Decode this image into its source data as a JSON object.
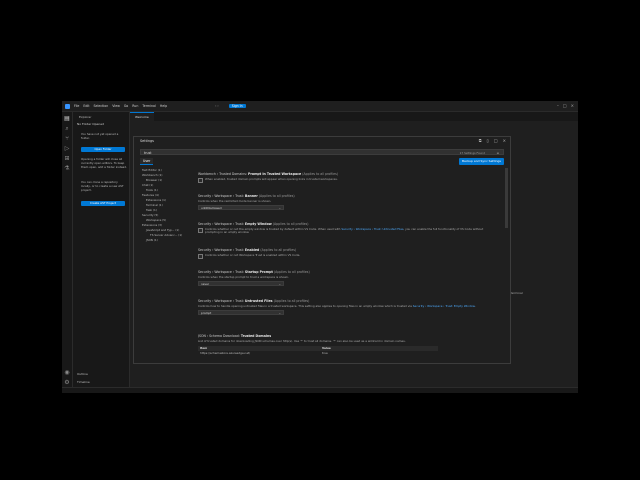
{
  "titlebar": {
    "menus": [
      "File",
      "Edit",
      "Selection",
      "View",
      "Go",
      "Run",
      "Terminal",
      "Help"
    ],
    "search_placeholder": "",
    "sign_in": "Sign In"
  },
  "sidebar": {
    "title": "Explorer",
    "section": "No Folder Opened",
    "text1": "You have not yet opened a folder.",
    "open_folder": "Open Folder",
    "text2": "Opening a folder will close all currently open editors. To keep them open, add a folder instead.",
    "text3": "You can clone a repository locally, or to create a new AST project.",
    "create_project": "Create AST Project",
    "outline": "Outline",
    "timeline": "Timeline"
  },
  "editor_tab": "Welcome",
  "dialog": {
    "title": "Settings",
    "search_value": "trust",
    "result_count": "17 Settings Found",
    "user_tab": "User",
    "backup_button": "Backup and Sync Settings",
    "tree": [
      {
        "label": "Text Editor (1)",
        "indent": 0
      },
      {
        "label": "Workbench (1)",
        "indent": 0
      },
      {
        "label": "Browser (1)",
        "indent": 1
      },
      {
        "label": "Chat (1)",
        "indent": 0
      },
      {
        "label": "Tools (1)",
        "indent": 1
      },
      {
        "label": "Features (4)",
        "indent": 0
      },
      {
        "label": "Extensions (1)",
        "indent": 1
      },
      {
        "label": "Terminal (1)",
        "indent": 1
      },
      {
        "label": "Task (1)",
        "indent": 1
      },
      {
        "label": "Security (5)",
        "indent": 0
      },
      {
        "label": "Workspace (5)",
        "indent": 1
      },
      {
        "label": "Extensions (3)",
        "indent": 0
      },
      {
        "label": "JavaScript and Typ... (1)",
        "indent": 1
      },
      {
        "label": "TS Server Advanc... (1)",
        "indent": 2
      },
      {
        "label": "JSON (1)",
        "indent": 1
      }
    ],
    "settings": {
      "s1": {
        "prefix": "Workbench › Trusted Domains: ",
        "name": "Prompt In Trusted Workspace",
        "scope": "(Applies to all profiles)",
        "desc": "When enabled, trusted domain prompts will appear when opening links in trusted workspaces."
      },
      "s2": {
        "prefix": "Security › Workspace › Trust: ",
        "name": "Banner",
        "scope": "(Applies to all profiles)",
        "desc": "Controls when the restricted mode banner is shown.",
        "value": "untilDismissed"
      },
      "s3": {
        "prefix": "Security › Workspace › Trust: ",
        "name": "Empty Window",
        "scope": "(Applies to all profiles)",
        "desc_a": "Controls whether or not the empty window is trusted by default within VS Code. When used with ",
        "link": "Security › Workspace › Trust: Untrusted Files",
        "desc_b": ", you can enable the full functionality of VS Code without prompting in an empty window."
      },
      "s4": {
        "prefix": "Security › Workspace › Trust: ",
        "name": "Enabled",
        "scope": "(Applies to all profiles)",
        "desc": "Controls whether or not Workspace Trust is enabled within VS Code."
      },
      "s5": {
        "prefix": "Security › Workspace › Trust: ",
        "name": "Startup Prompt",
        "scope": "(Applies to all profiles)",
        "desc": "Controls when the startup prompt to trust a workspace is shown.",
        "value": "never"
      },
      "s6": {
        "prefix": "Security › Workspace › Trust: ",
        "name": "Untrusted Files",
        "scope": "(Applies to all profiles)",
        "desc_a": "Controls how to handle opening untrusted files in a trusted workspace. This setting also applies to opening files in an empty window which is trusted via ",
        "link": "Security › Workspace › Trust: Empty Window",
        "desc_b": ".",
        "value": "prompt"
      },
      "s7": {
        "prefix": "JSON › Schema Download: ",
        "name": "Trusted Domains",
        "scope": "",
        "desc": "List of trusted domains for downloading JSON schemas over http(s). Use '*' to trust all domains. '*' can also be used as a wildcard in domain names.",
        "col_item": "Item",
        "col_value": "Value",
        "row_item": "https://schemastore.azureedge.net/",
        "row_value": "true"
      }
    }
  },
  "panel_header": "Terminal"
}
